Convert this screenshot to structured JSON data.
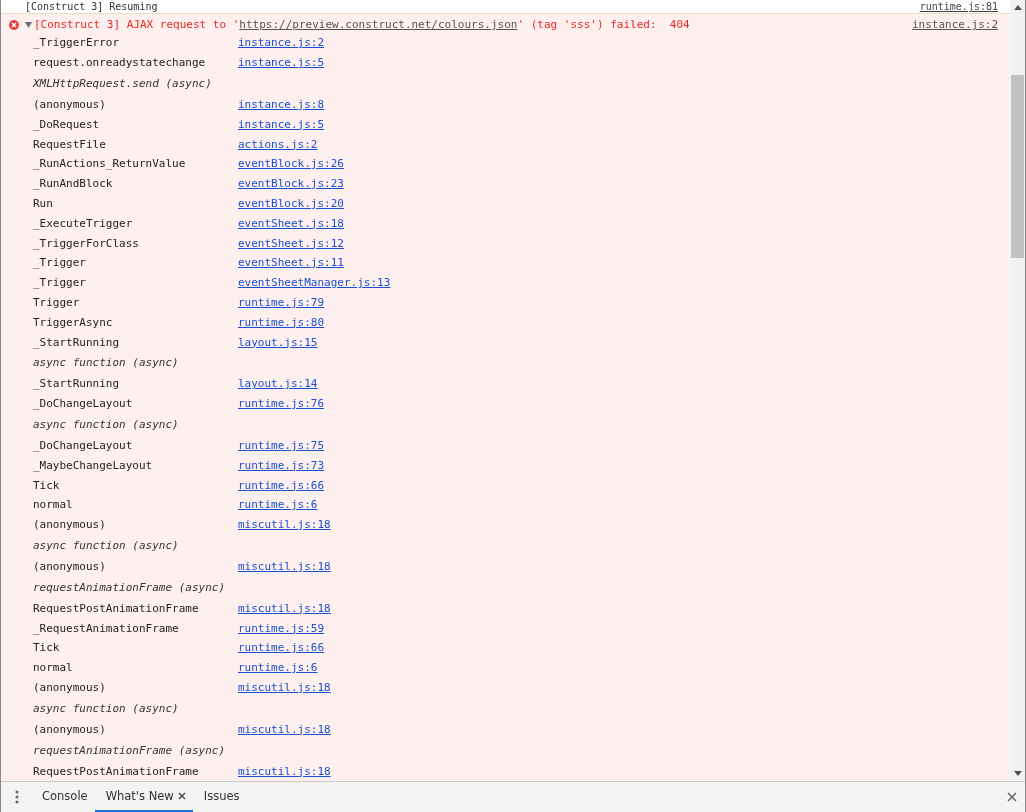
{
  "previous_message": {
    "text": "[Construct 3] Resuming",
    "source": "runtime.js:81"
  },
  "error": {
    "expanded": true,
    "message_start": "[Construct 3] AJAX request to '",
    "url": "https://preview.construct.net/colours.json",
    "message_end": "' (tag 'sss') failed:  404",
    "source": "instance.js:2",
    "stack": [
      {
        "kind": "frame",
        "name": "_TriggerError",
        "link": "instance.js:2"
      },
      {
        "kind": "frame",
        "name": "request.onreadystatechange",
        "link": "instance.js:5"
      },
      {
        "kind": "async",
        "name": "XMLHttpRequest.send (async)"
      },
      {
        "kind": "frame",
        "name": "(anonymous)",
        "link": "instance.js:8"
      },
      {
        "kind": "frame",
        "name": "_DoRequest",
        "link": "instance.js:5"
      },
      {
        "kind": "frame",
        "name": "RequestFile",
        "link": "actions.js:2"
      },
      {
        "kind": "frame",
        "name": "_RunActions_ReturnValue",
        "link": "eventBlock.js:26"
      },
      {
        "kind": "frame",
        "name": "_RunAndBlock",
        "link": "eventBlock.js:23"
      },
      {
        "kind": "frame",
        "name": "Run",
        "link": "eventBlock.js:20"
      },
      {
        "kind": "frame",
        "name": "_ExecuteTrigger",
        "link": "eventSheet.js:18"
      },
      {
        "kind": "frame",
        "name": "_TriggerForClass",
        "link": "eventSheet.js:12"
      },
      {
        "kind": "frame",
        "name": "_Trigger",
        "link": "eventSheet.js:11"
      },
      {
        "kind": "frame",
        "name": "_Trigger",
        "link": "eventSheetManager.js:13"
      },
      {
        "kind": "frame",
        "name": "Trigger",
        "link": "runtime.js:79"
      },
      {
        "kind": "frame",
        "name": "TriggerAsync",
        "link": "runtime.js:80"
      },
      {
        "kind": "frame",
        "name": "_StartRunning",
        "link": "layout.js:15"
      },
      {
        "kind": "async",
        "name": "async function (async)"
      },
      {
        "kind": "frame",
        "name": "_StartRunning",
        "link": "layout.js:14"
      },
      {
        "kind": "frame",
        "name": "_DoChangeLayout",
        "link": "runtime.js:76"
      },
      {
        "kind": "async",
        "name": "async function (async)"
      },
      {
        "kind": "frame",
        "name": "_DoChangeLayout",
        "link": "runtime.js:75"
      },
      {
        "kind": "frame",
        "name": "_MaybeChangeLayout",
        "link": "runtime.js:73"
      },
      {
        "kind": "frame",
        "name": "Tick",
        "link": "runtime.js:66"
      },
      {
        "kind": "frame",
        "name": "normal",
        "link": "runtime.js:6"
      },
      {
        "kind": "frame",
        "name": "(anonymous)",
        "link": "miscutil.js:18"
      },
      {
        "kind": "async",
        "name": "async function (async)"
      },
      {
        "kind": "frame",
        "name": "(anonymous)",
        "link": "miscutil.js:18"
      },
      {
        "kind": "async",
        "name": "requestAnimationFrame (async)"
      },
      {
        "kind": "frame",
        "name": "RequestPostAnimationFrame",
        "link": "miscutil.js:18"
      },
      {
        "kind": "frame",
        "name": "_RequestAnimationFrame",
        "link": "runtime.js:59"
      },
      {
        "kind": "frame",
        "name": "Tick",
        "link": "runtime.js:66"
      },
      {
        "kind": "frame",
        "name": "normal",
        "link": "runtime.js:6"
      },
      {
        "kind": "frame",
        "name": "(anonymous)",
        "link": "miscutil.js:18"
      },
      {
        "kind": "async",
        "name": "async function (async)"
      },
      {
        "kind": "frame",
        "name": "(anonymous)",
        "link": "miscutil.js:18"
      },
      {
        "kind": "async",
        "name": "requestAnimationFrame (async)"
      },
      {
        "kind": "frame",
        "name": "RequestPostAnimationFrame",
        "link": "miscutil.js:18"
      }
    ]
  },
  "drawer_tabs": [
    {
      "label": "Console",
      "selected": false,
      "closable": false
    },
    {
      "label": "What's New",
      "selected": true,
      "closable": true
    },
    {
      "label": "Issues",
      "selected": false,
      "closable": false
    }
  ]
}
